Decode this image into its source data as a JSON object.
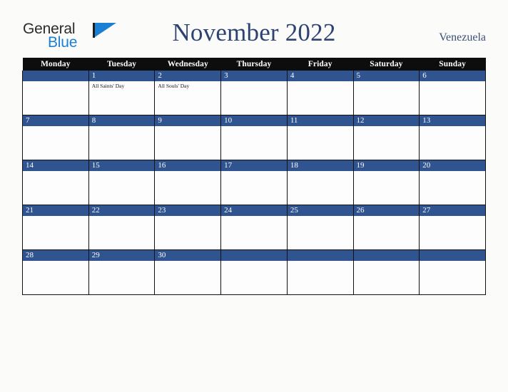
{
  "brand": {
    "name_part1": "General",
    "name_part2": "Blue",
    "accent_color": "#1b7fd4",
    "text_color": "#2b2b2b",
    "triangle_icon": "triangle-logo-icon"
  },
  "header": {
    "title": "November 2022",
    "country": "Venezuela",
    "title_color": "#2e4372"
  },
  "calendar": {
    "header_bg": "#0d0d0d",
    "daybar_bg": "#2f548f",
    "weekday_headers": [
      "Monday",
      "Tuesday",
      "Wednesday",
      "Thursday",
      "Friday",
      "Saturday",
      "Sunday"
    ],
    "weeks": [
      [
        {
          "date": "",
          "events": []
        },
        {
          "date": "1",
          "events": [
            "All Saints' Day"
          ]
        },
        {
          "date": "2",
          "events": [
            "All Souls' Day"
          ]
        },
        {
          "date": "3",
          "events": []
        },
        {
          "date": "4",
          "events": []
        },
        {
          "date": "5",
          "events": []
        },
        {
          "date": "6",
          "events": []
        }
      ],
      [
        {
          "date": "7",
          "events": []
        },
        {
          "date": "8",
          "events": []
        },
        {
          "date": "9",
          "events": []
        },
        {
          "date": "10",
          "events": []
        },
        {
          "date": "11",
          "events": []
        },
        {
          "date": "12",
          "events": []
        },
        {
          "date": "13",
          "events": []
        }
      ],
      [
        {
          "date": "14",
          "events": []
        },
        {
          "date": "15",
          "events": []
        },
        {
          "date": "16",
          "events": []
        },
        {
          "date": "17",
          "events": []
        },
        {
          "date": "18",
          "events": []
        },
        {
          "date": "19",
          "events": []
        },
        {
          "date": "20",
          "events": []
        }
      ],
      [
        {
          "date": "21",
          "events": []
        },
        {
          "date": "22",
          "events": []
        },
        {
          "date": "23",
          "events": []
        },
        {
          "date": "24",
          "events": []
        },
        {
          "date": "25",
          "events": []
        },
        {
          "date": "26",
          "events": []
        },
        {
          "date": "27",
          "events": []
        }
      ],
      [
        {
          "date": "28",
          "events": []
        },
        {
          "date": "29",
          "events": []
        },
        {
          "date": "30",
          "events": []
        },
        {
          "date": "",
          "events": []
        },
        {
          "date": "",
          "events": []
        },
        {
          "date": "",
          "events": []
        },
        {
          "date": "",
          "events": []
        }
      ]
    ]
  }
}
